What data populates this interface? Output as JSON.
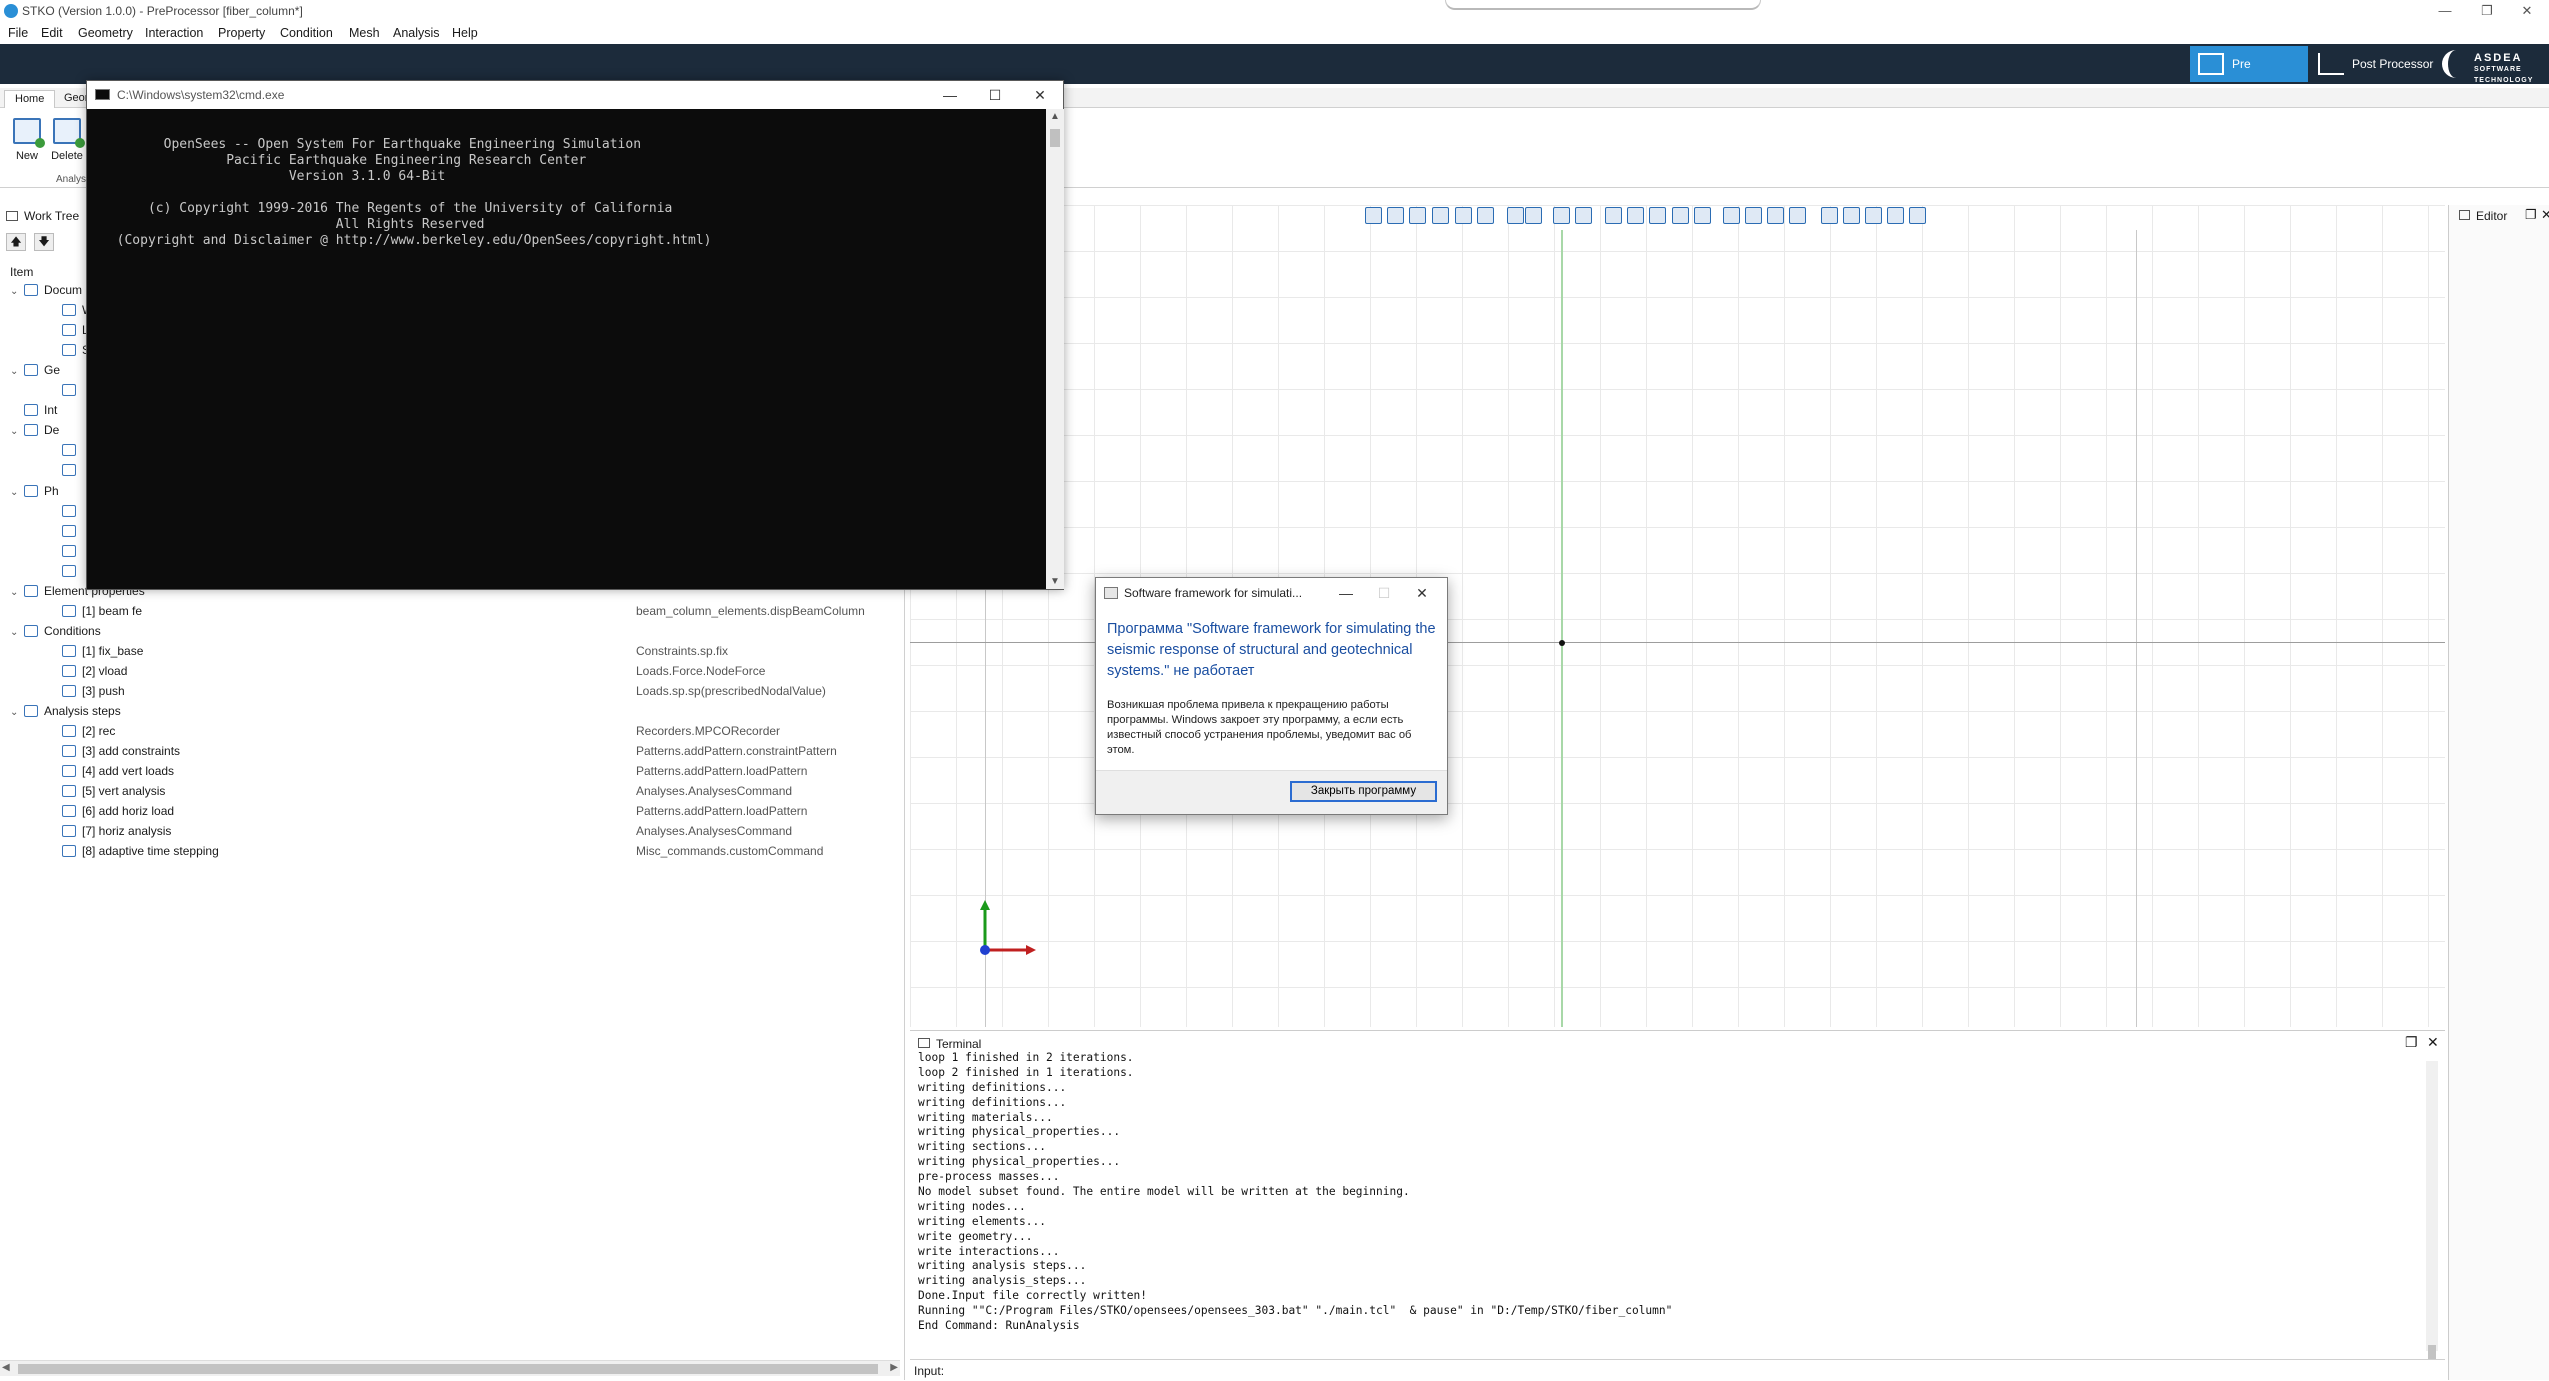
{
  "window": {
    "title": "STKO (Version 1.0.0) - PreProcessor [fiber_column*]",
    "controls": [
      "—",
      "❐",
      "✕"
    ]
  },
  "menu": [
    "File",
    "Edit",
    "Geometry",
    "Interaction",
    "Property",
    "Condition",
    "Mesh",
    "Analysis",
    "Help"
  ],
  "modes": {
    "pre": "Pre Processor",
    "post": "Post Processor"
  },
  "brand": {
    "line1": "ASDEA",
    "line2": "SOFTWARE",
    "line3": "TECHNOLOGY"
  },
  "ribbon": {
    "tabs": [
      "Home",
      "Geom"
    ],
    "buttons": [
      "New",
      "Delete"
    ],
    "group": "Analys"
  },
  "worktree": {
    "title": "Work Tree",
    "column_item": "Item",
    "rows": [
      {
        "label": "Docum",
        "type": "",
        "indent": 0,
        "expanded": true
      },
      {
        "label": "Wo",
        "type": "",
        "indent": 1
      },
      {
        "label": "Loc",
        "type": "",
        "indent": 1
      },
      {
        "label": "Sel",
        "type": "",
        "indent": 1
      },
      {
        "label": "Ge",
        "type": "",
        "indent": 0,
        "expanded": true
      },
      {
        "label": "",
        "type": "",
        "indent": 1
      },
      {
        "label": "Int",
        "type": "",
        "indent": 0
      },
      {
        "label": "De",
        "type": "",
        "indent": 0,
        "expanded": true
      },
      {
        "label": "",
        "type": "",
        "indent": 1
      },
      {
        "label": "",
        "type": "",
        "indent": 1
      },
      {
        "label": "Ph",
        "type": "",
        "indent": 0,
        "expanded": true
      },
      {
        "label": "",
        "type": "",
        "indent": 1
      },
      {
        "label": "",
        "type": "",
        "indent": 1
      },
      {
        "label": "",
        "type": "",
        "indent": 1
      },
      {
        "label": "",
        "type": "",
        "indent": 1
      },
      {
        "label": "Element properties",
        "type": "",
        "indent": 0,
        "expanded": true
      },
      {
        "label": "[1] beam fe",
        "type": "beam_column_elements.dispBeamColumn",
        "indent": 1
      },
      {
        "label": "Conditions",
        "type": "",
        "indent": 0,
        "expanded": true
      },
      {
        "label": "[1] fix_base",
        "type": "Constraints.sp.fix",
        "indent": 1
      },
      {
        "label": "[2] vload",
        "type": "Loads.Force.NodeForce",
        "indent": 1
      },
      {
        "label": "[3] push",
        "type": "Loads.sp.sp(prescribedNodalValue)",
        "indent": 1
      },
      {
        "label": "Analysis steps",
        "type": "",
        "indent": 0,
        "expanded": true
      },
      {
        "label": "[2] rec",
        "type": "Recorders.MPCORecorder",
        "indent": 1
      },
      {
        "label": "[3] add constraints",
        "type": "Patterns.addPattern.constraintPattern",
        "indent": 1
      },
      {
        "label": "[4] add vert loads",
        "type": "Patterns.addPattern.loadPattern",
        "indent": 1
      },
      {
        "label": "[5] vert analysis",
        "type": "Analyses.AnalysesCommand",
        "indent": 1
      },
      {
        "label": "[6] add horiz load",
        "type": "Patterns.addPattern.loadPattern",
        "indent": 1
      },
      {
        "label": "[7] horiz analysis",
        "type": "Analyses.AnalysesCommand",
        "indent": 1
      },
      {
        "label": "[8] adaptive time stepping",
        "type": "Misc_commands.customCommand",
        "indent": 1
      }
    ]
  },
  "editor": {
    "title": "Editor"
  },
  "terminal": {
    "title": "Terminal",
    "input_label": "Input:",
    "input_value": "",
    "lines": [
      "loop 1 finished in 2 iterations.",
      "loop 2 finished in 1 iterations.",
      "writing definitions...",
      "writing definitions...",
      "writing materials...",
      "writing physical_properties...",
      "writing sections...",
      "writing physical_properties...",
      "pre-process masses...",
      "No model subset found. The entire model will be written at the beginning.",
      "writing nodes...",
      "writing elements...",
      "write geometry...",
      "write interactions...",
      "writing analysis steps...",
      "writing analysis_steps...",
      "Done.Input file correctly written!",
      "Running \"\"C:/Program Files/STKO/opensees/opensees_303.bat\" \"./main.tcl\"  & pause\" in \"D:/Temp/STKO/fiber_column\"",
      "End Command: RunAnalysis"
    ]
  },
  "cmd": {
    "title": "C:\\Windows\\system32\\cmd.exe",
    "lines": [
      "        OpenSees -- Open System For Earthquake Engineering Simulation",
      "                Pacific Earthquake Engineering Research Center",
      "                        Version 3.1.0 64-Bit",
      "",
      "      (c) Copyright 1999-2016 The Regents of the University of California",
      "                              All Rights Reserved",
      "  (Copyright and Disclaimer @ http://www.berkeley.edu/OpenSees/copyright.html)"
    ]
  },
  "dialog": {
    "title": "Software framework for simulati...",
    "heading": "Программа \"Software framework for simulating the seismic response of structural and geotechnical systems.\" не работает",
    "text": "Возникшая проблема привела к прекращению работы программы. Windows закроет эту программу, а если есть известный способ устранения проблемы, уведомит вас об этом.",
    "button": "Закрыть программу"
  },
  "colors": {
    "accent": "#2a8fd6",
    "darkbar": "#1c2b3b",
    "dialog_heading": "#1a4ea1"
  }
}
